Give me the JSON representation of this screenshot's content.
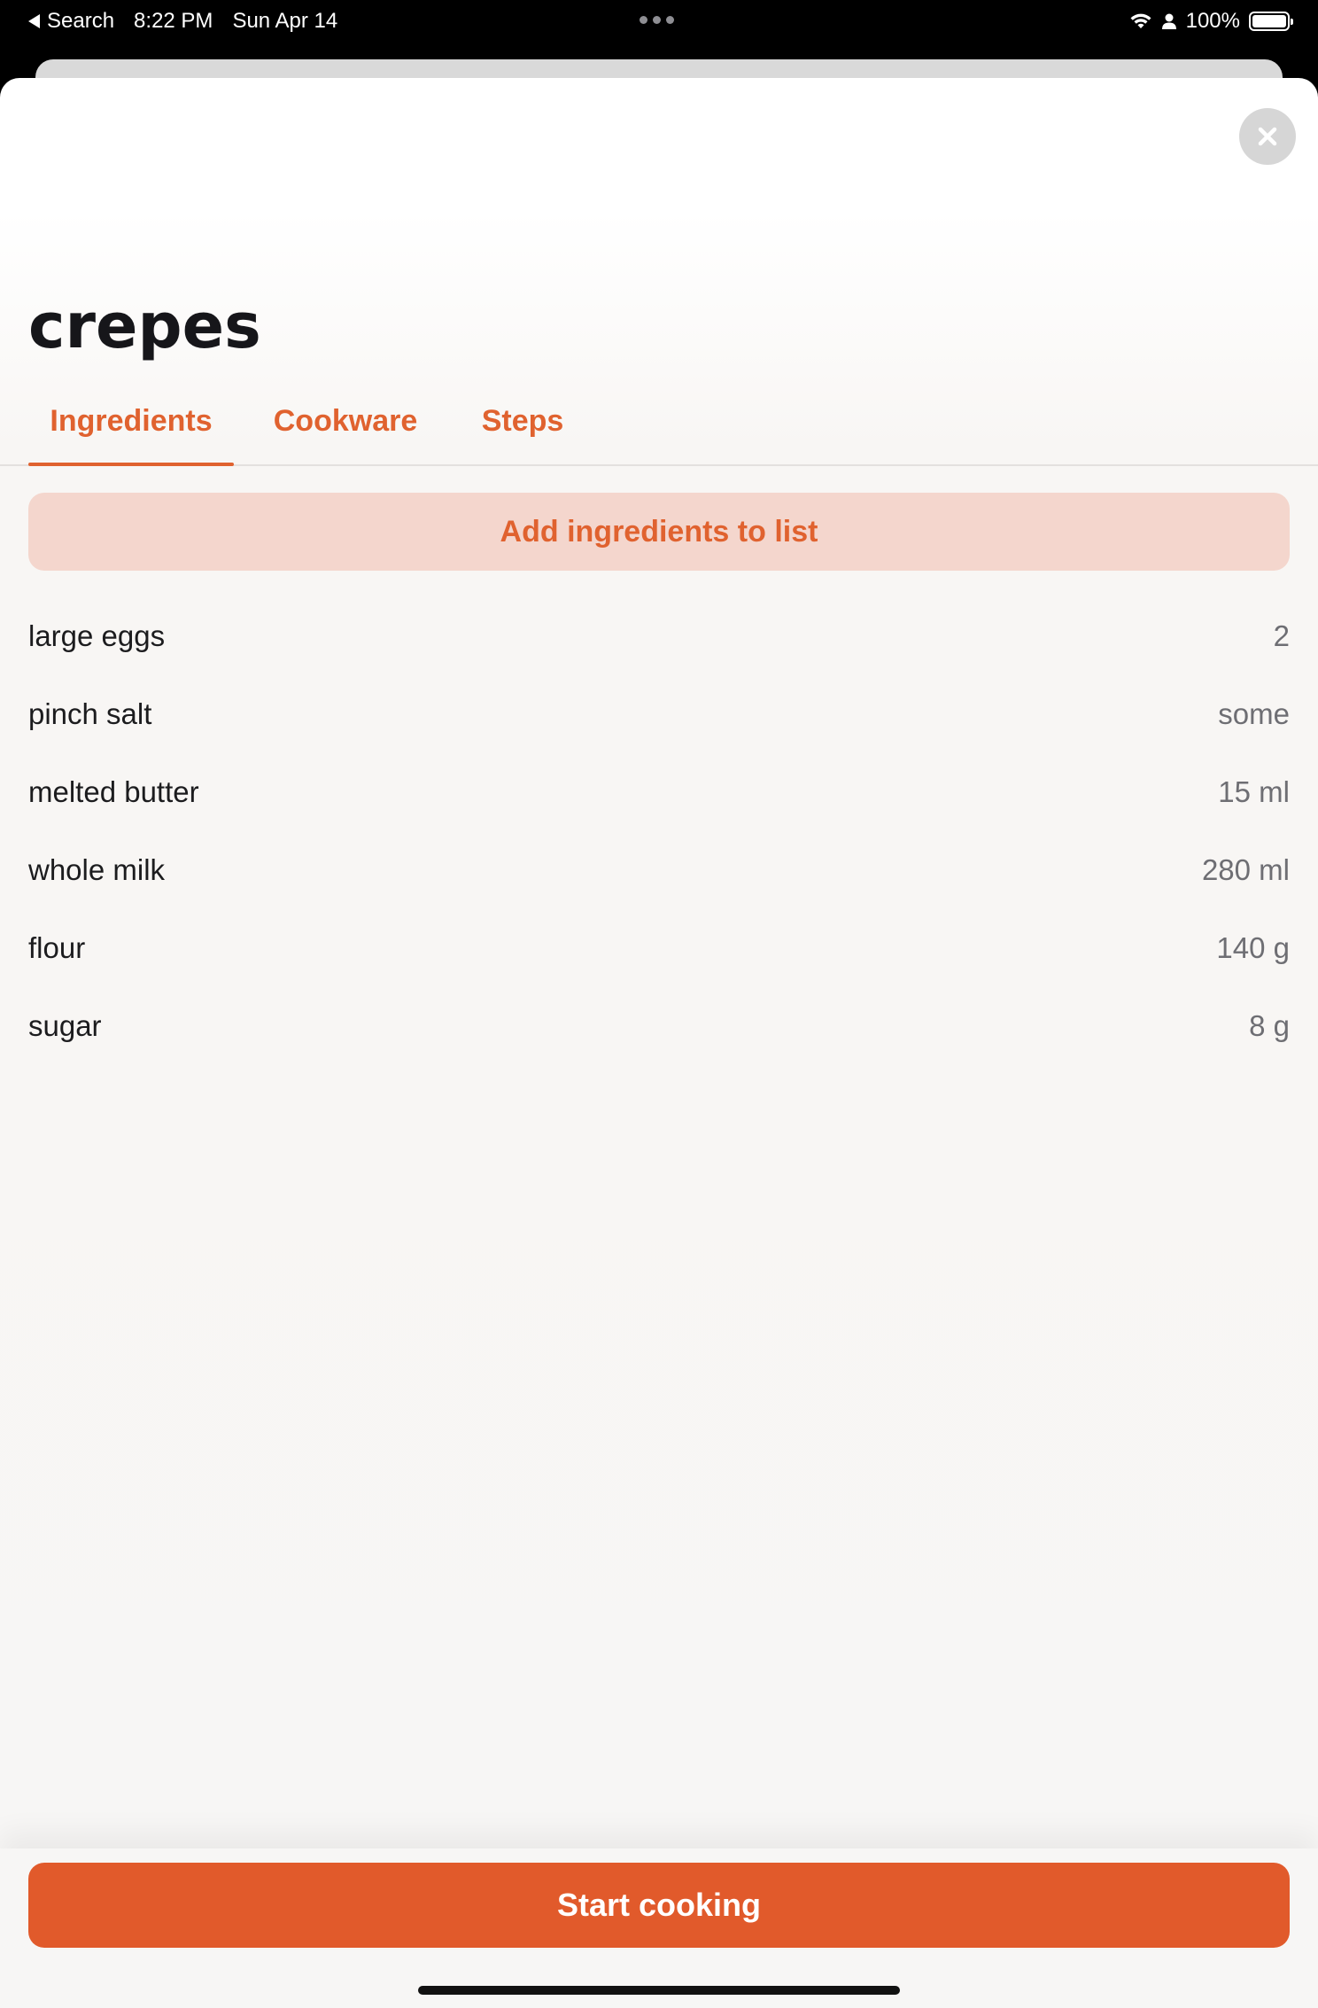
{
  "status_bar": {
    "back_label": "Search",
    "time": "8:22 PM",
    "date": "Sun Apr 14",
    "battery": "100%"
  },
  "recipe": {
    "title": "crepes"
  },
  "tabs": [
    {
      "label": "Ingredients",
      "active": true
    },
    {
      "label": "Cookware",
      "active": false
    },
    {
      "label": "Steps",
      "active": false
    }
  ],
  "add_to_list_label": "Add ingredients to list",
  "ingredients": [
    {
      "name": "large eggs",
      "quantity": "2"
    },
    {
      "name": "pinch salt",
      "quantity": "some"
    },
    {
      "name": "melted butter",
      "quantity": "15 ml"
    },
    {
      "name": "whole milk",
      "quantity": "280 ml"
    },
    {
      "name": "flour",
      "quantity": "140 g"
    },
    {
      "name": "sugar",
      "quantity": "8 g"
    }
  ],
  "start_cooking_label": "Start cooking",
  "colors": {
    "accent": "#e0622f",
    "accent_light": "#f4d6cd",
    "start_button": "#e15a2b"
  }
}
